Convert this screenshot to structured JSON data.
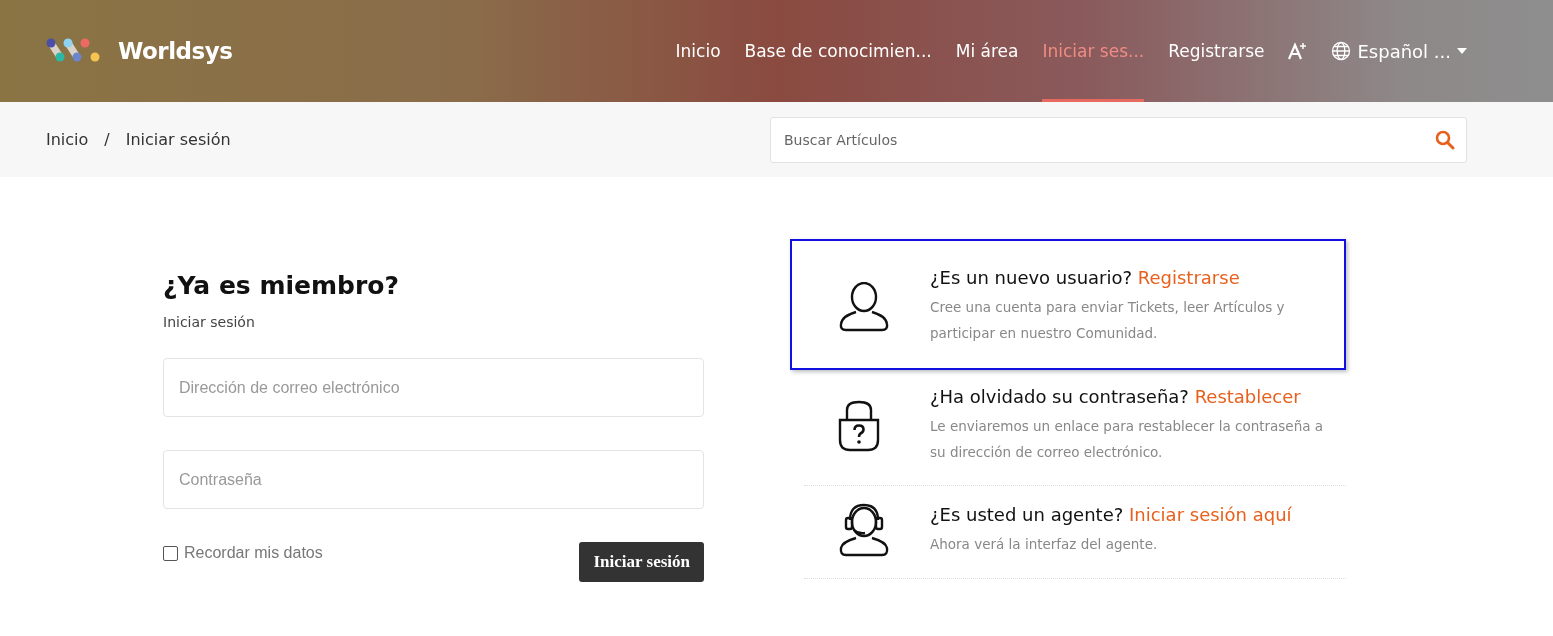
{
  "header": {
    "logo": "Worldsys",
    "nav": [
      {
        "label": "Inicio",
        "selected": false
      },
      {
        "label": "Base de conocimien...",
        "selected": false
      },
      {
        "label": "Mi área",
        "selected": false
      },
      {
        "label": "Iniciar ses...",
        "selected": true
      },
      {
        "label": "Registrarse",
        "selected": false
      }
    ],
    "language": "Español ..."
  },
  "breadcrumb": {
    "separator": "/",
    "items": [
      "Inicio",
      "Iniciar sesión"
    ]
  },
  "search": {
    "placeholder": "Buscar Artículos"
  },
  "login": {
    "title": "¿Ya es miembro?",
    "subtitle": "Iniciar sesión",
    "email_placeholder": "Dirección de correo electrónico",
    "password_placeholder": "Contraseña",
    "remember": {
      "label": "Recordar mis datos",
      "checked": false
    },
    "button": "Iniciar sesión"
  },
  "options": [
    {
      "kind": "user",
      "question": "¿Es un nuevo usuario?",
      "link": "Registrarse",
      "description": "Cree una cuenta para enviar Tickets, leer Artículos y participar en nuestro Comunidad.",
      "focused": true
    },
    {
      "kind": "lock",
      "question": "¿Ha olvidado su contraseña?",
      "link": "Restablecer",
      "description": "Le enviaremos un enlace para restablecer la contraseña a su dirección de correo electrónico.",
      "focused": false
    },
    {
      "kind": "agent",
      "question": "¿Es usted un agente?",
      "link": "Iniciar sesión aquí",
      "description": "Ahora verá la interfaz del agente.",
      "focused": false
    }
  ]
}
